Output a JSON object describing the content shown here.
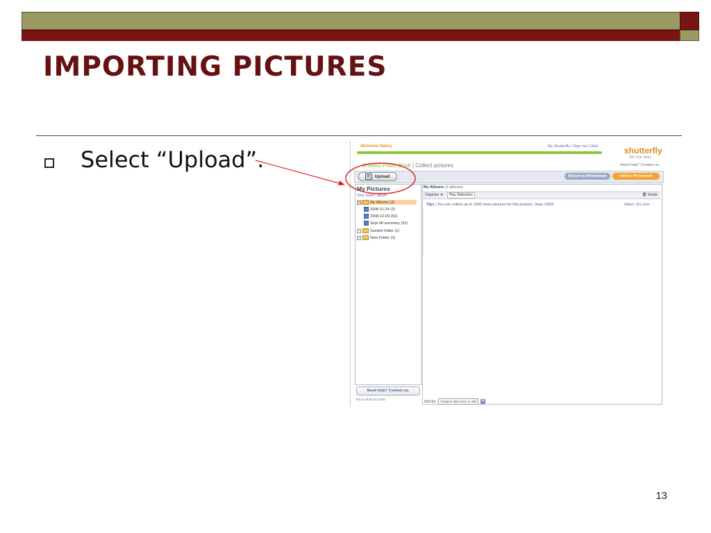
{
  "slide": {
    "title": "IMPORTING PICTURES",
    "bullet": "Select “Upload”.",
    "page_number": "13"
  },
  "colors": {
    "banner_olive": "#9a9a62",
    "banner_maroon": "#7a1414",
    "title": "#661111",
    "annotation_red": "#e02020"
  },
  "screenshot": {
    "welcome": "Welcome Nancy",
    "top_links": "My Shutterfly | Sign out | Help",
    "logo": "shutterfly",
    "logo_tagline": "Tell Your Story",
    "book_title": "Untitled Photo Book",
    "separator": " | ",
    "book_subtitle": "Collect pictures",
    "need_help_top": "Need help? Contact us.",
    "upload_label": "Upload",
    "return_label": "Return to Photobook",
    "add_label": "Add to Photobook",
    "my_pictures": "My Pictures",
    "panel_links": "New: folder | album",
    "tree": {
      "my_albums": "My Albums (3)",
      "album_1": "2008-11-24 (2)",
      "album_2": "2008-10-09 (52)",
      "album_3": "Sept 08 summary (51)",
      "sample_folder": "Sample folder (1)",
      "new_folder": "New Folder (2)"
    },
    "help_button": "Need help? Contact us.",
    "tell_us": "Tell us what you think.",
    "albums_header": "My Albums",
    "albums_count": "(3 albums)",
    "organize": "Organize ▼",
    "play_slideshow": "Play Slideshow",
    "delete": "Delete",
    "tips_label": "Tips",
    "tips_text": "You can collect up to 1000 more pictures for this product. (max 1000)",
    "select_label": "Select:",
    "select_all": "all",
    "select_none": "none",
    "sort_label": "Sort by:",
    "sort_value": "Creation date (new to old)"
  }
}
